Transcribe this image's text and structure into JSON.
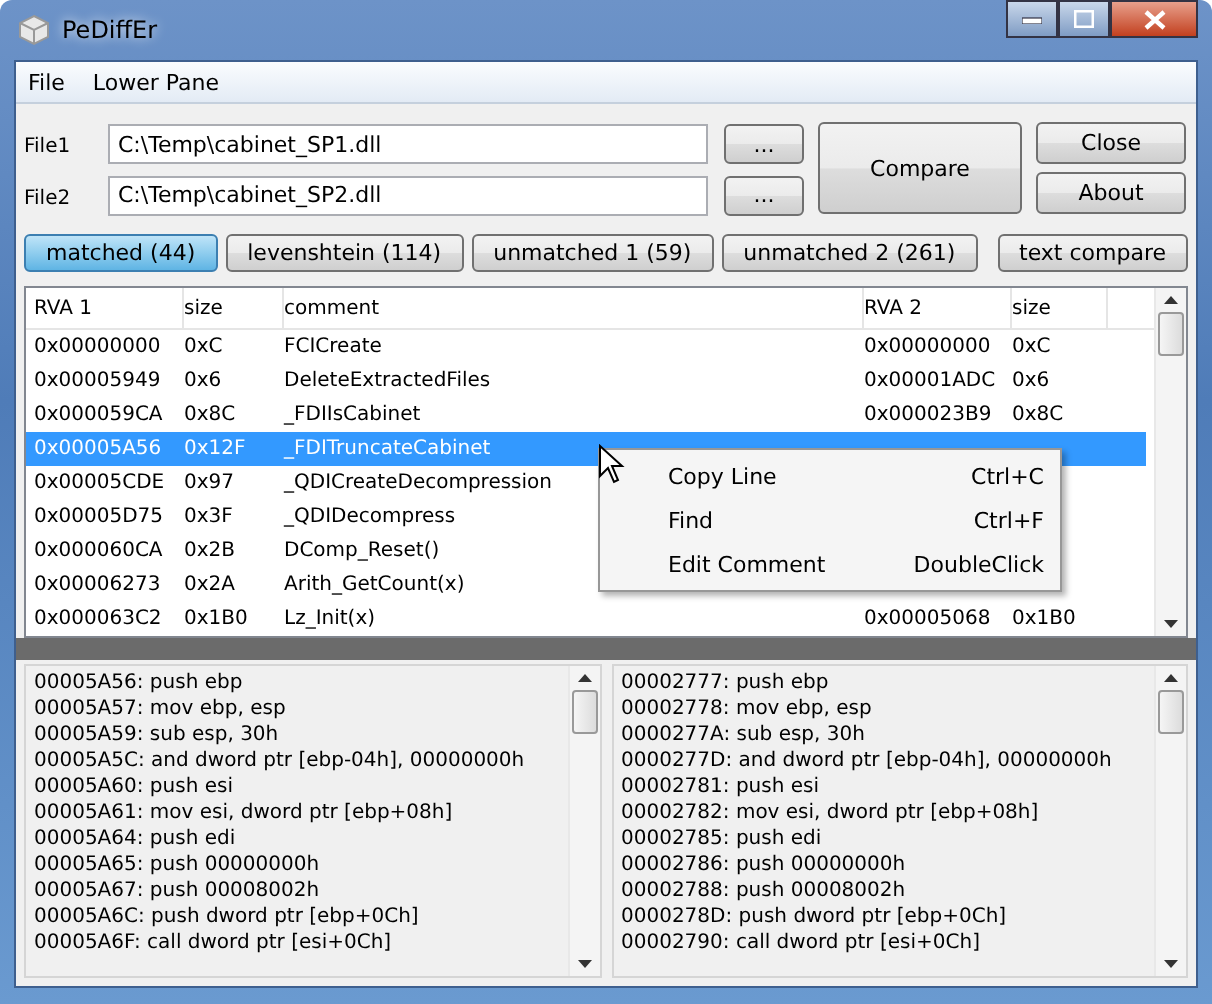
{
  "window": {
    "title": "PeDiffEr"
  },
  "menu": [
    "File",
    "Lower Pane"
  ],
  "files": [
    {
      "label": "File1",
      "value": "C:\\Temp\\cabinet_SP1.dll",
      "browse": "..."
    },
    {
      "label": "File2",
      "value": "C:\\Temp\\cabinet_SP2.dll",
      "browse": "..."
    }
  ],
  "compare_button": "Compare",
  "side_buttons": [
    "Close",
    "About"
  ],
  "tabs": [
    {
      "label": "matched (44)",
      "selected": true
    },
    {
      "label": "levenshtein (114)",
      "selected": false
    },
    {
      "label": "unmatched 1 (59)",
      "selected": false
    },
    {
      "label": "unmatched 2 (261)",
      "selected": false
    }
  ],
  "text_compare_button": "text compare",
  "table": {
    "columns": [
      "RVA 1",
      "size",
      "comment",
      "RVA 2",
      "size"
    ],
    "rows": [
      {
        "cells": [
          "0x00000000",
          "0xC",
          "FCICreate",
          "0x00000000",
          "0xC"
        ],
        "selected": false
      },
      {
        "cells": [
          "0x00005949",
          "0x6",
          "DeleteExtractedFiles",
          "0x00001ADC",
          "0x6"
        ],
        "selected": false
      },
      {
        "cells": [
          "0x000059CA",
          "0x8C",
          "_FDIIsCabinet",
          "0x000023B9",
          "0x8C"
        ],
        "selected": false
      },
      {
        "cells": [
          "0x00005A56",
          "0x12F",
          "_FDITruncateCabinet"
        ],
        "selected": true
      },
      {
        "cells": [
          "0x00005CDE",
          "0x97",
          "_QDICreateDecompression"
        ],
        "selected": false
      },
      {
        "cells": [
          "0x00005D75",
          "0x3F",
          "_QDIDecompress"
        ],
        "selected": false
      },
      {
        "cells": [
          "0x000060CA",
          "0x2B",
          "DComp_Reset()"
        ],
        "selected": false
      },
      {
        "cells": [
          "0x00006273",
          "0x2A",
          "Arith_GetCount(x)"
        ],
        "selected": false
      },
      {
        "cells": [
          "0x000063C2",
          "0x1B0",
          "Lz_Init(x)",
          "0x00005068",
          "0x1B0"
        ],
        "selected": false
      }
    ]
  },
  "context_menu": [
    {
      "label": "Copy Line",
      "shortcut": "Ctrl+C"
    },
    {
      "label": "Find",
      "shortcut": "Ctrl+F"
    },
    {
      "label": "Edit Comment",
      "shortcut": "DoubleClick"
    }
  ],
  "lower_panes": [
    {
      "lines": [
        "00005A56: push ebp",
        "00005A57: mov ebp, esp",
        "00005A59: sub esp, 30h",
        "00005A5C: and dword ptr [ebp-04h], 00000000h",
        "00005A60: push esi",
        "00005A61: mov esi, dword ptr [ebp+08h]",
        "00005A64: push edi",
        "00005A65: push 00000000h",
        "00005A67: push 00008002h",
        "00005A6C: push dword ptr [ebp+0Ch]",
        "00005A6F: call dword ptr [esi+0Ch]"
      ]
    },
    {
      "lines": [
        "00002777: push ebp",
        "00002778: mov ebp, esp",
        "0000277A: sub esp, 30h",
        "0000277D: and dword ptr [ebp-04h], 00000000h",
        "00002781: push esi",
        "00002782: mov esi, dword ptr [ebp+08h]",
        "00002785: push edi",
        "00002786: push 00000000h",
        "00002788: push 00008002h",
        "0000278D: push dword ptr [ebp+0Ch]",
        "00002790: call dword ptr [esi+0Ch]"
      ]
    }
  ]
}
